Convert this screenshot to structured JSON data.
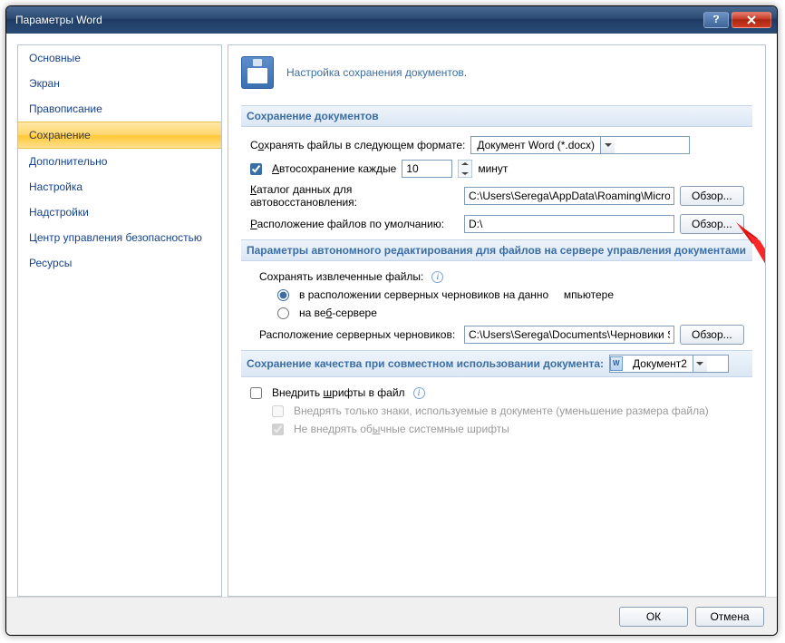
{
  "window": {
    "title": "Параметры Word"
  },
  "sidebar": {
    "items": [
      "Основные",
      "Экран",
      "Правописание",
      "Сохранение",
      "Дополнительно",
      "Настройка",
      "Надстройки",
      "Центр управления безопасностью",
      "Ресурсы"
    ],
    "selected_index": 3
  },
  "heading": "Настройка сохранения документов.",
  "section_save": {
    "title": "Сохранение документов",
    "format_label_pre": "С",
    "format_label_u": "о",
    "format_label_post": "хранять файлы в следующем формате:",
    "format_value": "Документ Word (*.docx)",
    "autosave_checked": true,
    "autosave_u": "А",
    "autosave_post": "втосохранение каждые",
    "autosave_value": "10",
    "autosave_unit": "минут",
    "recover_u": "К",
    "recover_post": "аталог данных для автовосстановления:",
    "recover_path": "C:\\Users\\Serega\\AppData\\Roaming\\Microsof",
    "default_u": "Р",
    "default_post": "асположение файлов по умолчанию:",
    "default_path": "D:\\",
    "browse": "Обзор..."
  },
  "section_offline": {
    "title": "Параметры автономного редактирования для файлов на сервере управления документами",
    "keep_label": "Сохранять извлеченные файлы:",
    "opt_local_pre": "в расположении серверных черновиков на данно",
    "opt_local_post": "мпьютере",
    "opt_web_pre": "на ве",
    "opt_web_u": "б",
    "opt_web_post": "-сервере",
    "drafts_label": "Расположение серверных черновиков:",
    "drafts_path": "C:\\Users\\Serega\\Documents\\Черновики Share",
    "browse": "Обзор..."
  },
  "section_quality": {
    "title": "Сохранение качества при совместном использовании документа:",
    "doc_name": "Документ2",
    "embed_pre": "Внедрить ",
    "embed_u": "ш",
    "embed_post": "рифты в файл",
    "sub1": "Внедрять только знаки, используемые в документе (уменьшение размера файла)",
    "sub2_pre": "Не внедрять об",
    "sub2_u": "ы",
    "sub2_post": "чные системные шрифты"
  },
  "footer": {
    "ok": "ОК",
    "cancel": "Отмена"
  }
}
